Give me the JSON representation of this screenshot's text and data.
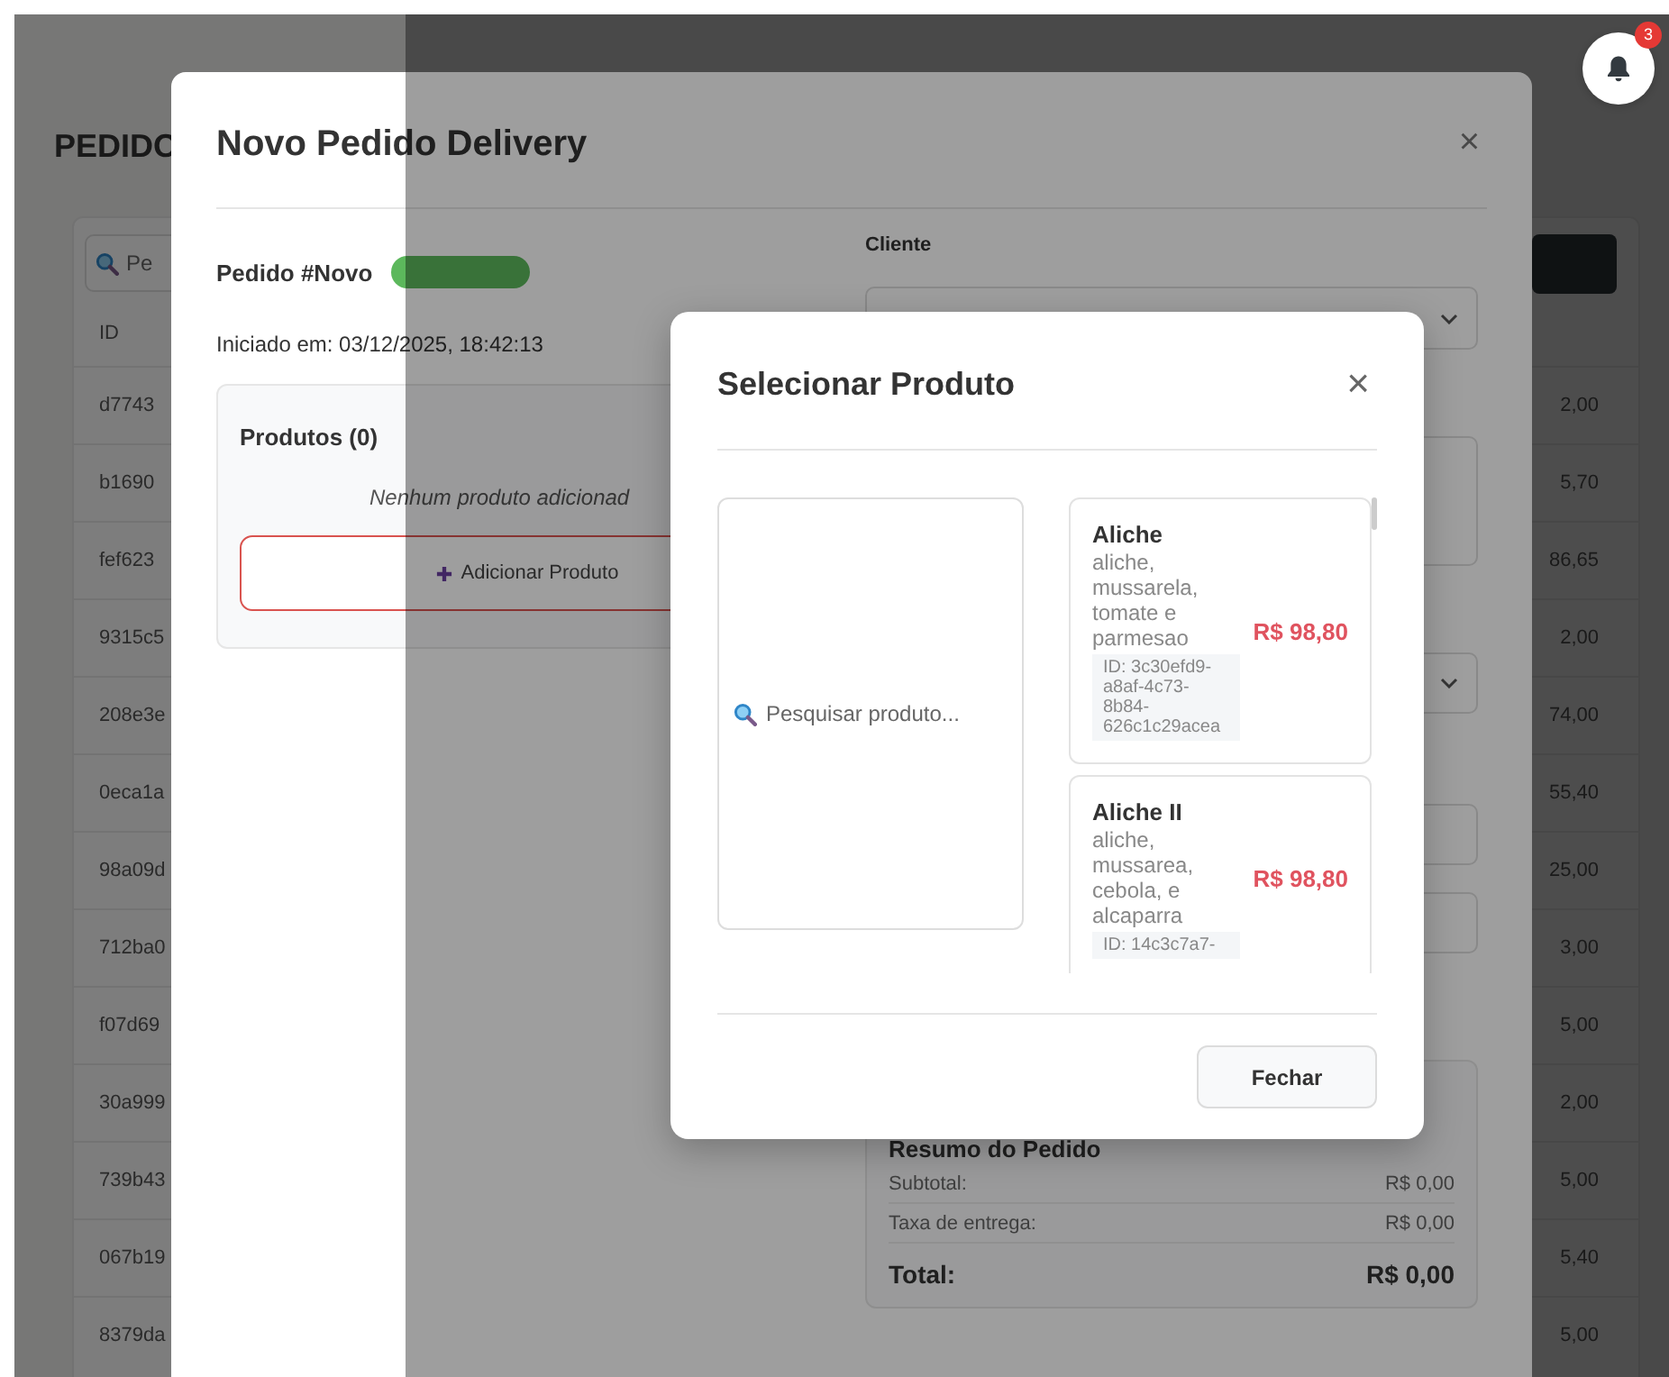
{
  "page": {
    "title": "PEDIDO",
    "search": {
      "placeholder": "Pe"
    },
    "orders_table": {
      "columns": [
        "ID"
      ],
      "rows": [
        {
          "id": "d7743",
          "amount": "2,00"
        },
        {
          "id": "b1690",
          "amount": "5,70"
        },
        {
          "id": "fef623",
          "amount": "86,65"
        },
        {
          "id": "9315c5",
          "amount": "2,00"
        },
        {
          "id": "208e3e",
          "amount": "74,00"
        },
        {
          "id": "0eca1a",
          "amount": "55,40"
        },
        {
          "id": "98a09d",
          "amount": "25,00"
        },
        {
          "id": "712ba0",
          "amount": "3,00"
        },
        {
          "id": "f07d69",
          "amount": "5,00"
        },
        {
          "id": "30a999",
          "amount": "2,00"
        },
        {
          "id": "739b43",
          "amount": "5,00"
        },
        {
          "id": "067b19",
          "amount": "5,40"
        },
        {
          "id": "8379da",
          "amount": "5,00"
        }
      ]
    }
  },
  "notifications": {
    "count": "3"
  },
  "order_modal": {
    "title": "Novo Pedido Delivery",
    "close": "×",
    "order_label": "Pedido #Novo",
    "started": "Iniciado em: 03/12/2025, 18:42:13",
    "products_title": "Produtos (0)",
    "empty_message": "Nenhum produto adicionad",
    "add_button": "Adicionar Produto",
    "customer_label": "Cliente",
    "summary": {
      "title": "Resumo do Pedido",
      "lines": [
        {
          "label": "Subtotal:",
          "value": "R$ 0,00",
          "kind": "normal"
        },
        {
          "label": "Taxa de entrega:",
          "value": "R$ 0,00",
          "kind": "normal"
        },
        {
          "label": "Total:",
          "value": "R$ 0,00",
          "kind": "total"
        }
      ]
    }
  },
  "product_modal": {
    "title": "Selecionar Produto",
    "close": "×",
    "search": {
      "placeholder": "Pesquisar produto..."
    },
    "products": [
      {
        "name": "Aliche",
        "description": "aliche, mussarela, tomate e parmesao",
        "id": "ID: 3c30efd9-a8af-4c73-8b84-626c1c29acea",
        "price": "R$ 98,80"
      },
      {
        "name": "Aliche II",
        "description": "aliche, mussarea, cebola, e alcaparra",
        "id": "ID: 14c3c7a7-",
        "price": "R$ 98,80"
      }
    ],
    "close_button": "Fechar"
  }
}
